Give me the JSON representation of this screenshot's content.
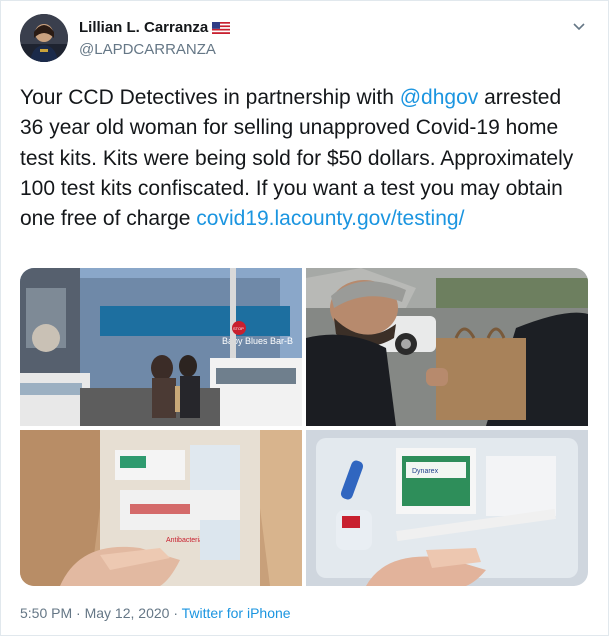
{
  "author": {
    "display_name": "Lillian L. Carranza",
    "handle": "@LAPDCARRANZA",
    "flag_icon": "us-flag-icon"
  },
  "menu": {
    "icon": "chevron-down-icon"
  },
  "tweet": {
    "text_1": "Your CCD Detectives in partnership with ",
    "mention": "@dhgov",
    "text_2": " arrested 36 year old woman for selling unapproved Covid-19 home test kits.  Kits were being sold for $50 dollars.  Approximately 100 test kits confiscated.  If you want a test you may obtain one free of charge ",
    "link": "covid19.lacounty.gov/testing/"
  },
  "media": {
    "photo_1": {
      "storefront_sign": "Baby Blues Bar-B",
      "stop_sign": "STOP"
    },
    "photo_2": {},
    "photo_3": {
      "box_text": "Antibacterial"
    },
    "photo_4": {
      "pad_brand": "Dynarex"
    }
  },
  "footer": {
    "time": "5:50 PM",
    "separator_1": " · ",
    "date": "May 12, 2020",
    "separator_2": " · ",
    "source": "Twitter for iPhone"
  },
  "colors": {
    "link": "#1b95e0",
    "text": "#14171a",
    "muted": "#657786"
  }
}
